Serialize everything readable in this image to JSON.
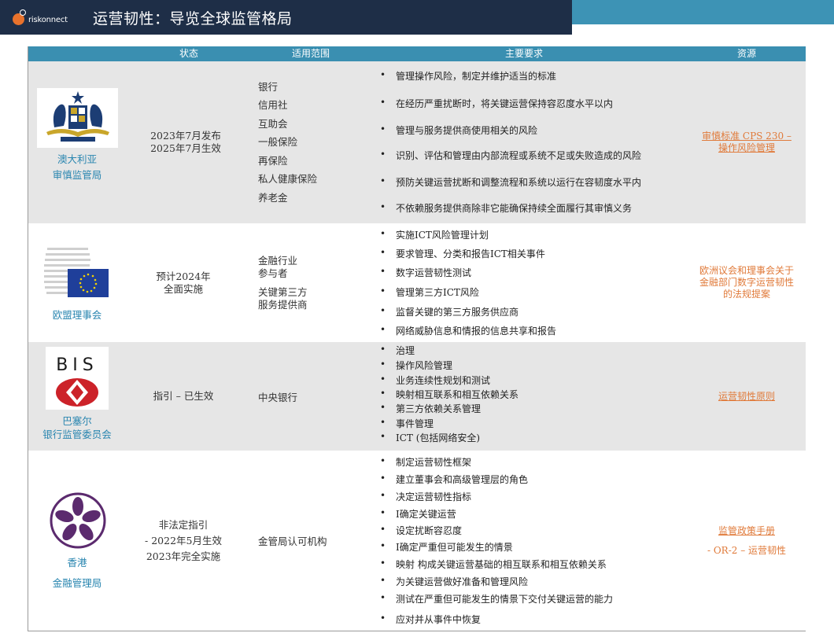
{
  "header": {
    "logo_text": "riskonnect",
    "title": "运营韧性：导览全球监管格局"
  },
  "colors": {
    "header_bg": "#1e2e47",
    "header_accent": "#3d93b5",
    "table_header": "#3a8fb1",
    "org_name": "#2a86b0",
    "link": "#e07a3a",
    "row_shade": "#e6e6e6"
  },
  "table": {
    "columns": [
      "状态",
      "适用范围",
      "主要要求",
      "资源"
    ],
    "rows": [
      {
        "org_lines": [
          "澳大利亚",
          "审慎监管局"
        ],
        "logo_icon": "australian-coat-of-arms-icon",
        "status": [
          "2023年7月发布",
          "2025年7月生效"
        ],
        "scope": [
          "银行",
          "信用社",
          "互助会",
          "一般保险",
          "再保险",
          "私人健康保险",
          "养老金"
        ],
        "requirements": [
          "管理操作风险，制定并维护适当的标准",
          "在经历严重扰断时，将关键运营保持容忍度水平以内",
          "管理与服务提供商使用相关的风险",
          "识别、评估和管理由内部流程或系统不足或失败造成的风险",
          "预防关键运营扰断和调整流程和系统以运行在容韧度水平内",
          "不依赖服务提供商除非它能确保持续全面履行其审慎义务"
        ],
        "resources": [
          "审慎标准 CPS 230 –",
          "操作风险管理"
        ]
      },
      {
        "org_lines": [
          "欧盟理事会"
        ],
        "logo_icon": "eu-council-icon",
        "status": [
          "预计2024年",
          "全面实施"
        ],
        "scope": [
          "金融行业",
          "参与者",
          "",
          "关键第三方",
          "服务提供商"
        ],
        "requirements": [
          "实施ICT风险管理计划",
          "要求管理、分类和报告ICT相关事件",
          "数字运营韧性测试",
          "管理第三方ICT风险",
          "监督关键的第三方服务供应商",
          "网络威胁信息和情报的信息共享和报告"
        ],
        "resources": [
          "欧洲议会和理事会关于",
          "金融部门数字运营韧性",
          "的法规提案"
        ]
      },
      {
        "org_lines": [
          "巴塞尔",
          "银行监管委员会"
        ],
        "logo_icon": "bis-logo-icon",
        "logo_text": "BIS",
        "status": [
          "指引 – 已生效"
        ],
        "scope": [
          "中央银行"
        ],
        "requirements": [
          "治理",
          "操作风险管理",
          "业务连续性规划和测试",
          "映射相互联系和相互依赖关系",
          "第三方依赖关系管理",
          "事件管理",
          "ICT (包括网络安全)"
        ],
        "resources": [
          "运营韧性原则"
        ]
      },
      {
        "org_lines": [
          "香港",
          "金融管理局"
        ],
        "logo_icon": "bauhinia-flower-icon",
        "status": [
          "非法定指引",
          "- 2022年5月生效",
          "2023年完全实施"
        ],
        "scope": [
          "金管局认可机构"
        ],
        "requirements": [
          "制定运营韧性框架",
          "建立董事会和高级管理层的角色",
          "决定运营韧性指标",
          "I确定关键运营",
          "设定扰断容忍度",
          "I确定严重但可能发生的情景",
          "映射 构成关键运营基础的相互联系和相互依赖关系",
          "为关键运营做好准备和管理风险",
          "测试在严重但可能发生的情景下交付关键运营的能力",
          "应对并从事件中恢复"
        ],
        "resources": [
          "监管政策手册",
          "-  OR-2 – 运营韧性"
        ]
      }
    ]
  }
}
